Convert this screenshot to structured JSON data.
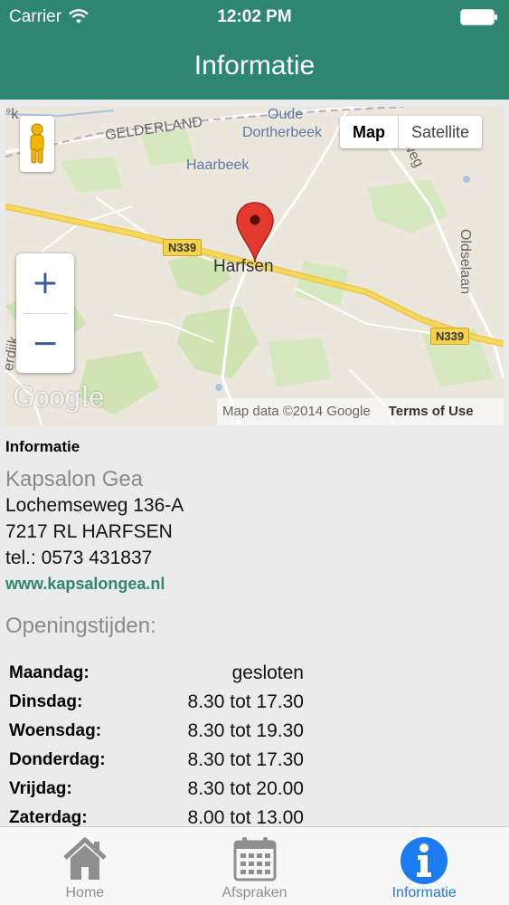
{
  "status_bar": {
    "carrier": "Carrier",
    "time": "12:02 PM"
  },
  "nav": {
    "title": "Informatie"
  },
  "map": {
    "maptype": {
      "map": "Map",
      "satellite": "Satellite"
    },
    "zoom": {
      "in": "+",
      "out": "−"
    },
    "labels": {
      "gelderland": "GELDERLAND",
      "oude": "Oude",
      "dortherbeek": "Dortherbeek",
      "haarbeek": "Haarbeek",
      "harfsen": "Harfsen",
      "oldselaan": "Oldselaan",
      "weg": "weg",
      "edge_k": "°k",
      "edge_left": "erdijk"
    },
    "shields": {
      "n339_a": "N339",
      "n339_b": "N339"
    },
    "logo": "Google",
    "attribution": "Map data ©2014 Google",
    "terms": "Terms of Use"
  },
  "info": {
    "section_title": "Informatie",
    "salon_name": "Kapsalon Gea",
    "street": "Lochemseweg 136-A",
    "city": "7217 RL HARFSEN",
    "phone": "tel.: 0573 431837",
    "website": "www.kapsalongea.nl"
  },
  "hours": {
    "title": "Openingstijden:",
    "rows": [
      {
        "day": "Maandag:",
        "time": "gesloten"
      },
      {
        "day": "Dinsdag:",
        "time": "8.30 tot 17.30"
      },
      {
        "day": "Woensdag:",
        "time": "8.30 tot 19.30"
      },
      {
        "day": "Donderdag:",
        "time": "8.30 tot 17.30"
      },
      {
        "day": "Vrijdag:",
        "time": "8.30 tot 20.00"
      },
      {
        "day": "Zaterdag:",
        "time": "8.00 tot 13.00"
      }
    ]
  },
  "tabs": [
    {
      "label": "Home",
      "icon": "home-icon"
    },
    {
      "label": "Afspraken",
      "icon": "calendar-icon"
    },
    {
      "label": "Informatie",
      "icon": "info-icon"
    }
  ],
  "colors": {
    "header": "#2e8570",
    "accent": "#2e8570",
    "tab_active": "#1a7cf0"
  }
}
